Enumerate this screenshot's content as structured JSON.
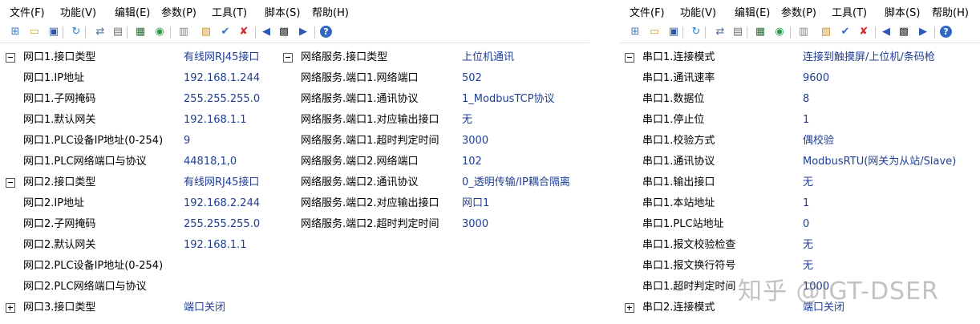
{
  "menu": [
    "文件(F)",
    "功能(V)",
    "编辑(E)",
    "参数(P)",
    "工具(T)",
    "脚本(S)",
    "帮助(H)"
  ],
  "toolbar_icons": [
    "network-tree-icon",
    "open-folder-icon",
    "save-icon",
    "refresh-icon",
    "connect-icon",
    "monitor-icon",
    "terminal-icon",
    "globe-icon",
    "grid-icon",
    "folder-config-icon",
    "check-icon",
    "close-icon",
    "prev-icon",
    "qc-icon",
    "next-icon",
    "help-icon"
  ],
  "left": {
    "network_rows": [
      {
        "key": "网口1.接口类型",
        "value": "有线网RJ45接口",
        "expander": "minus"
      },
      {
        "key": "网口1.IP地址",
        "value": "192.168.1.244"
      },
      {
        "key": "网口1.子网掩码",
        "value": "255.255.255.0"
      },
      {
        "key": "网口1.默认网关",
        "value": "192.168.1.1"
      },
      {
        "key": "网口1.PLC设备IP地址(0-254)",
        "value": "9"
      },
      {
        "key": "网口1.PLC网络端口与协议",
        "value": "44818,1,0"
      },
      {
        "key": "网口2.接口类型",
        "value": "有线网RJ45接口",
        "expander": "minus"
      },
      {
        "key": "网口2.IP地址",
        "value": "192.168.2.244"
      },
      {
        "key": "网口2.子网掩码",
        "value": "255.255.255.0"
      },
      {
        "key": "网口2.默认网关",
        "value": "192.168.1.1"
      },
      {
        "key": "网口2.PLC设备IP地址(0-254)",
        "value": ""
      },
      {
        "key": "网口2.PLC网络端口与协议",
        "value": ""
      },
      {
        "key": "网口3.接口类型",
        "value": "端口关闭",
        "expander": "plus"
      }
    ],
    "service_rows": [
      {
        "key": "网络服务.接口类型",
        "value": "上位机通讯",
        "expander": "minus"
      },
      {
        "key": "网络服务.端口1.网络端口",
        "value": "502"
      },
      {
        "key": "网络服务.端口1.通讯协议",
        "value": "1_ModbusTCP协议"
      },
      {
        "key": "网络服务.端口1.对应输出接口",
        "value": "无"
      },
      {
        "key": "网络服务.端口1.超时判定时间",
        "value": "3000"
      },
      {
        "key": "网络服务.端口2.网络端口",
        "value": "102"
      },
      {
        "key": "网络服务.端口2.通讯协议",
        "value": "0_透明传输/IP耦合隔离"
      },
      {
        "key": "网络服务.端口2.对应输出接口",
        "value": "网口1"
      },
      {
        "key": "网络服务.端口2.超时判定时间",
        "value": "3000"
      }
    ]
  },
  "right": {
    "serial_rows": [
      {
        "key": "串口1.连接模式",
        "value": "连接到触摸屏/上位机/条码枪",
        "expander": "minus"
      },
      {
        "key": "串口1.通讯速率",
        "value": "9600"
      },
      {
        "key": "串口1.数据位",
        "value": "8"
      },
      {
        "key": "串口1.停止位",
        "value": "1"
      },
      {
        "key": "串口1.校验方式",
        "value": "偶校验"
      },
      {
        "key": "串口1.通讯协议",
        "value": "ModbusRTU(网关为从站/Slave)"
      },
      {
        "key": "串口1.输出接口",
        "value": "无"
      },
      {
        "key": "串口1.本站地址",
        "value": "1"
      },
      {
        "key": "串口1.PLC站地址",
        "value": "0"
      },
      {
        "key": "串口1.报文校验检查",
        "value": "无"
      },
      {
        "key": "串口1.报文换行符号",
        "value": "无"
      },
      {
        "key": "串口1.超时判定时间",
        "value": "1000"
      },
      {
        "key": "串口2.连接模式",
        "value": "端口关闭",
        "expander": "plus"
      }
    ]
  },
  "watermark": "知乎 @IGT-DSER"
}
